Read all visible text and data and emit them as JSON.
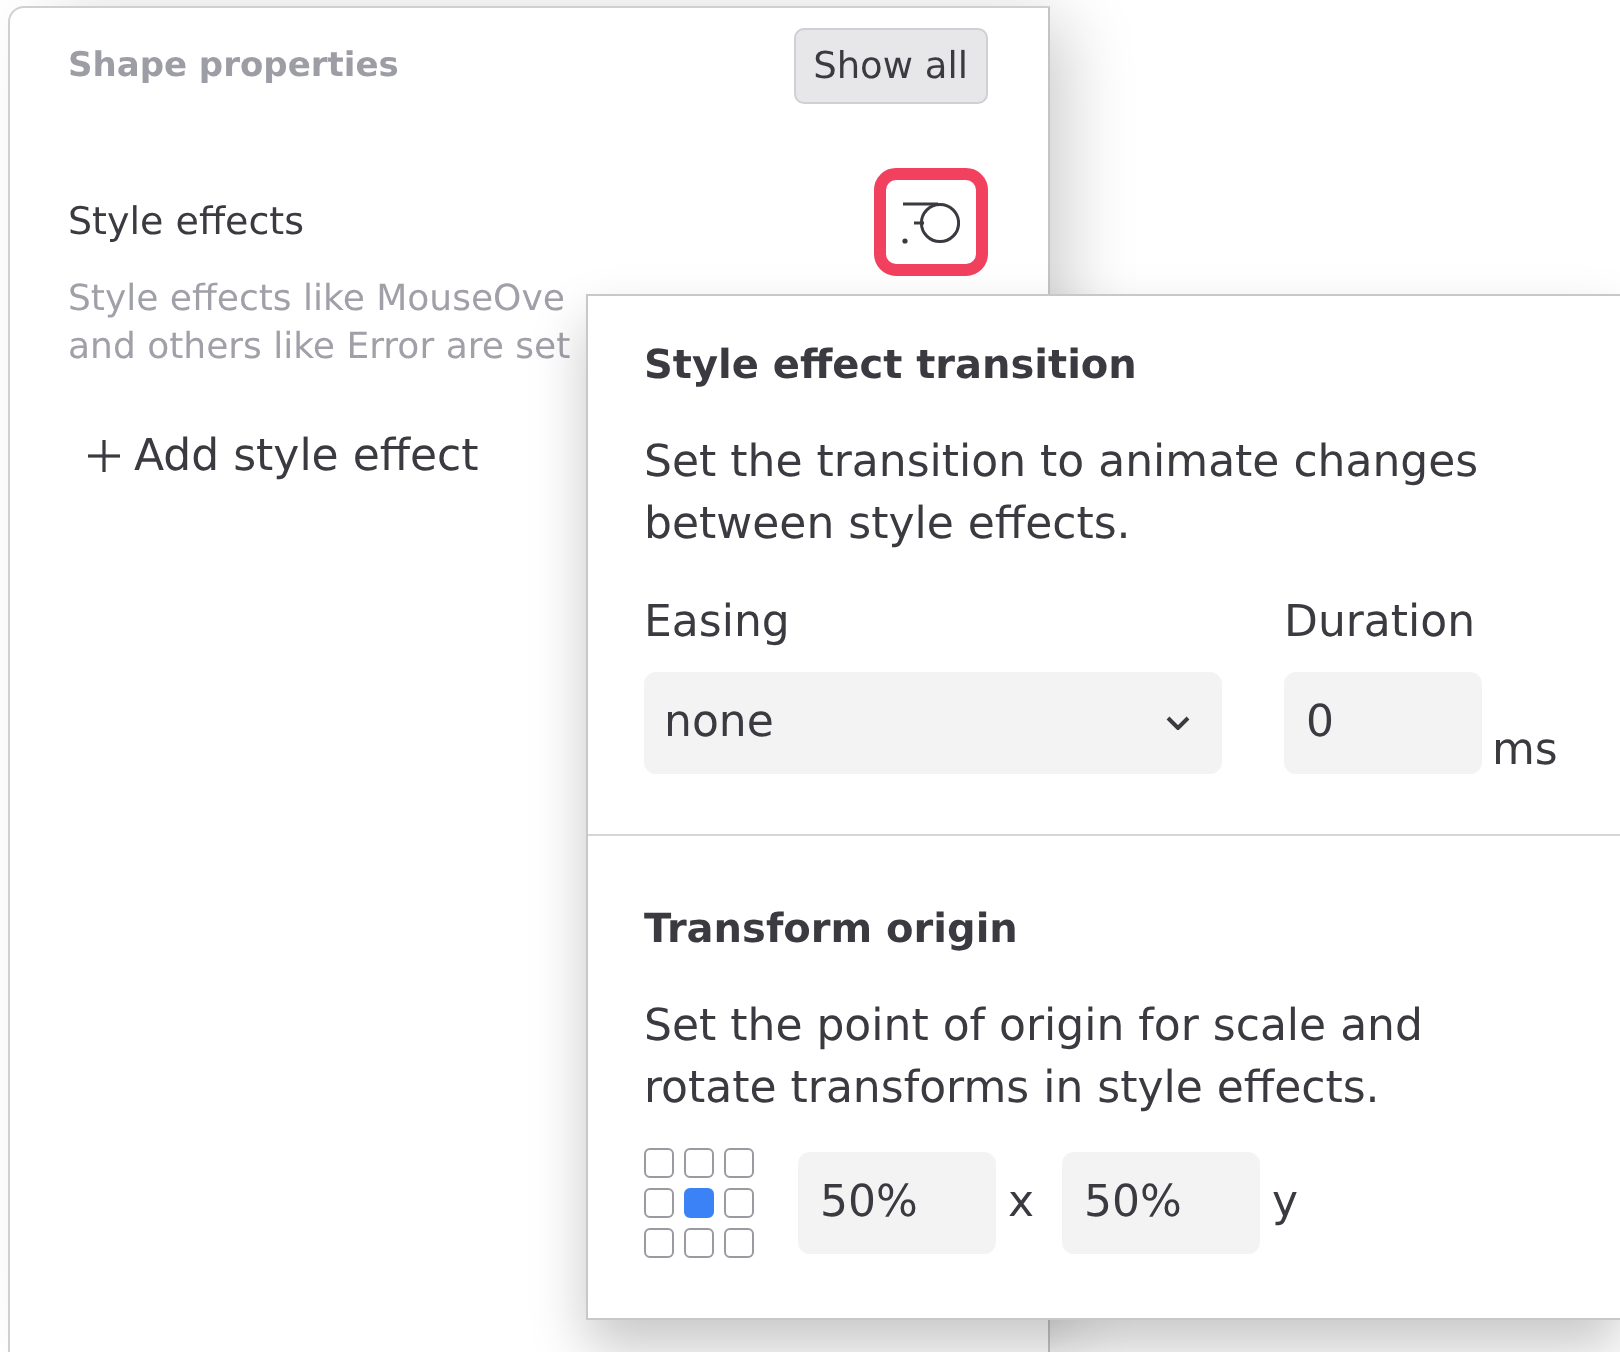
{
  "panel": {
    "title": "Shape properties",
    "show_all_button": "Show all",
    "style_effects": {
      "label": "Style effects",
      "transition_button": {
        "highlighted": true
      },
      "description_lines": [
        "Style effects like MouseOve",
        "and others like Error are set"
      ],
      "add_button": "Add style effect"
    }
  },
  "popover": {
    "sections": [
      {
        "kind": "transition",
        "title": "Style effect transition",
        "description": "Set the transition to animate changes between style effects.",
        "easing": {
          "label": "Easing",
          "value": "none"
        },
        "duration": {
          "label": "Duration",
          "value": "0",
          "unit": "ms"
        }
      },
      {
        "kind": "origin",
        "title": "Transform origin",
        "description": "Set the point of origin for scale and rotate transforms in style effects.",
        "points": [
          {
            "selected": false
          },
          {
            "selected": false
          },
          {
            "selected": false
          },
          {
            "selected": false
          },
          {
            "selected": true
          },
          {
            "selected": false
          },
          {
            "selected": false
          },
          {
            "selected": false
          },
          {
            "selected": false
          }
        ],
        "x": {
          "value": "50%",
          "unit": "x"
        },
        "y": {
          "value": "50%",
          "unit": "y"
        }
      }
    ]
  }
}
